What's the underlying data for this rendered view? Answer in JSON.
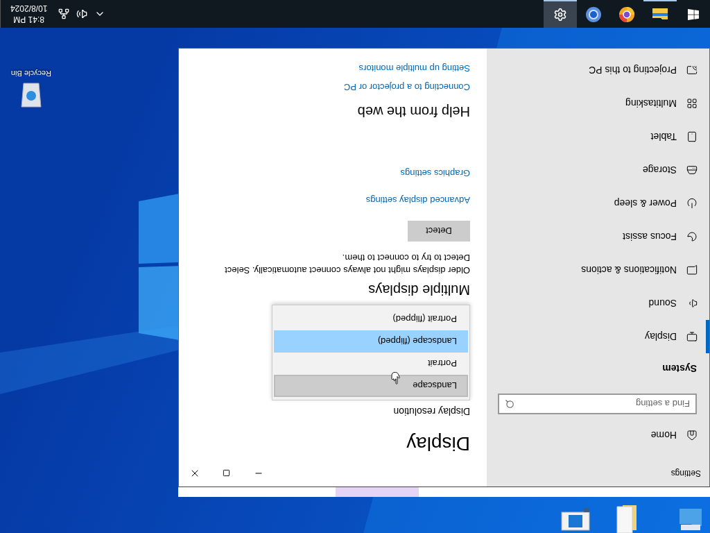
{
  "taskbar": {
    "apps": [
      {
        "kind": "start",
        "selected": false,
        "running": false
      },
      {
        "kind": "folder",
        "selected": false,
        "running": true
      },
      {
        "kind": "browser-canary",
        "selected": false,
        "running": false
      },
      {
        "kind": "browser",
        "selected": false,
        "running": false
      },
      {
        "kind": "settings",
        "selected": true,
        "running": true
      }
    ],
    "clock": {
      "time": "8:41 PM",
      "date": "10/8/2024"
    }
  },
  "desktop": {
    "icons": [
      {
        "label": "Recycle Bin"
      }
    ]
  },
  "window": {
    "title": "Settings",
    "sidebar": {
      "home": "Home",
      "search": {
        "placeholder": "Find a setting"
      },
      "section": "System",
      "items": [
        {
          "kind": "display",
          "label": "Display",
          "selected": true
        },
        {
          "kind": "sound",
          "label": "Sound",
          "selected": false
        },
        {
          "kind": "notifications",
          "label": "Notifications & actions",
          "selected": false
        },
        {
          "kind": "focus",
          "label": "Focus assist",
          "selected": false
        },
        {
          "kind": "power",
          "label": "Power & sleep",
          "selected": false
        },
        {
          "kind": "storage",
          "label": "Storage",
          "selected": false
        },
        {
          "kind": "tablet",
          "label": "Tablet",
          "selected": false
        },
        {
          "kind": "multitasking",
          "label": "Multitasking",
          "selected": false
        },
        {
          "kind": "projecting",
          "label": "Projecting to this PC",
          "selected": false
        }
      ]
    },
    "content": {
      "heading": "Display",
      "resolution_label": "Display resolution",
      "orientation_options": [
        {
          "label": "Landscape",
          "selected": false,
          "hovered": true
        },
        {
          "label": "Portrait",
          "selected": false,
          "hovered": false
        },
        {
          "label": "Landscape (flipped)",
          "selected": true,
          "hovered": false
        },
        {
          "label": "Portrait (flipped)",
          "selected": false,
          "hovered": false
        }
      ],
      "multiple_displays": {
        "heading": "Multiple displays",
        "description": "Older displays might not always connect automatically. Select Detect to try to connect to them.",
        "button": "Detect"
      },
      "links": [
        "Advanced display settings",
        "Graphics settings"
      ],
      "help": {
        "heading": "Help from the web",
        "links": [
          "Connecting to a projector or PC",
          "Setting up multiple monitors"
        ]
      }
    }
  }
}
